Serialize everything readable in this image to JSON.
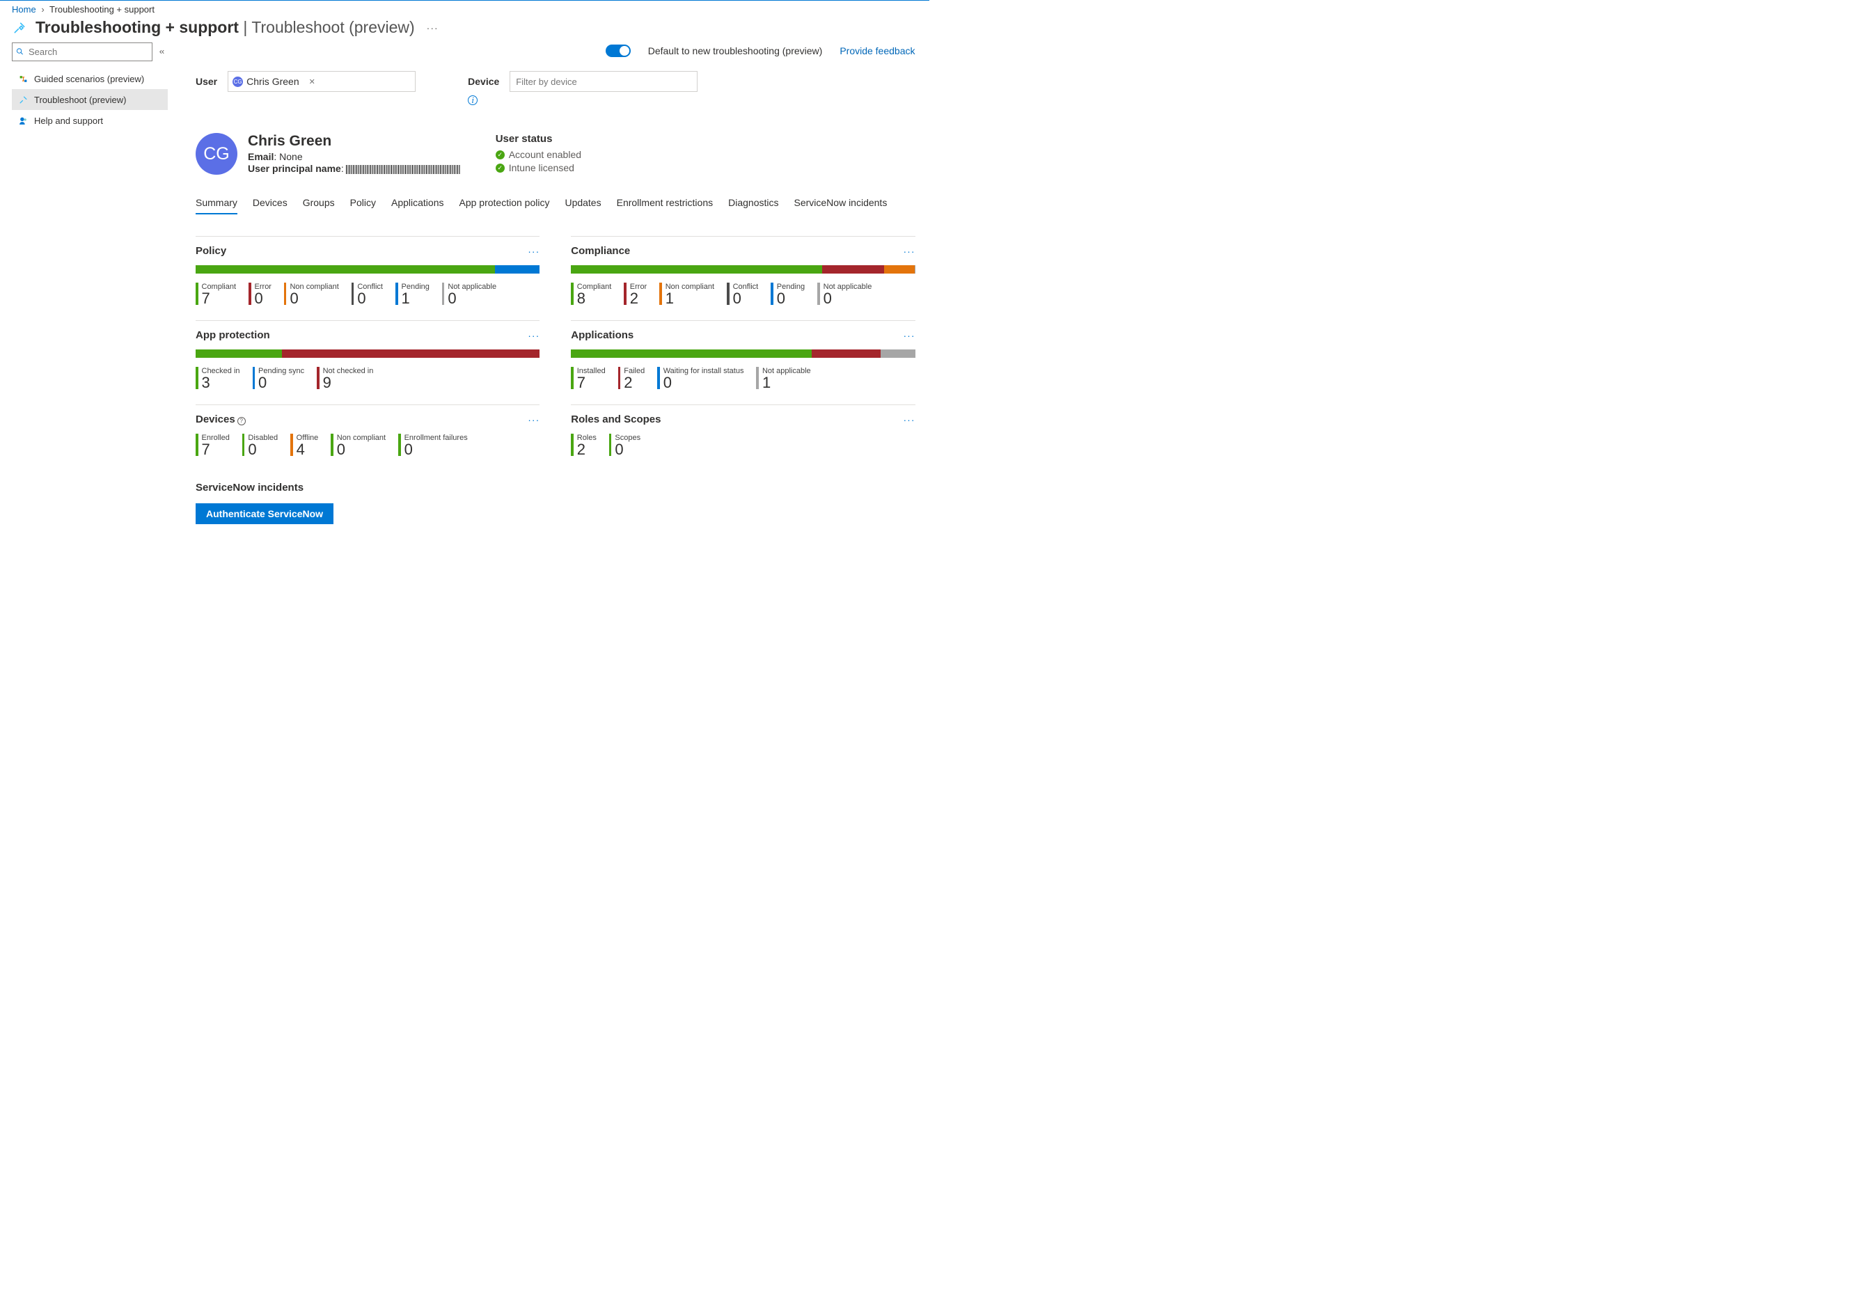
{
  "breadcrumb": {
    "home": "Home",
    "current": "Troubleshooting + support"
  },
  "header": {
    "title": "Troubleshooting + support",
    "subtitle": "Troubleshoot (preview)"
  },
  "sidebar": {
    "search_placeholder": "Search",
    "items": [
      {
        "label": "Guided scenarios (preview)"
      },
      {
        "label": "Troubleshoot (preview)"
      },
      {
        "label": "Help and support"
      }
    ]
  },
  "toprow": {
    "toggle_label": "Default to new troubleshooting (preview)",
    "feedback": "Provide feedback"
  },
  "filters": {
    "user_label": "User",
    "user_chip": "Chris Green",
    "user_initials": "CG",
    "device_label": "Device",
    "device_placeholder": "Filter by device"
  },
  "user": {
    "initials": "CG",
    "name": "Chris Green",
    "email_label": "Email",
    "email_value": "None",
    "upn_label": "User principal name",
    "status_header": "User status",
    "status_lines": [
      "Account enabled",
      "Intune licensed"
    ]
  },
  "tabs": [
    "Summary",
    "Devices",
    "Groups",
    "Policy",
    "Applications",
    "App protection policy",
    "Updates",
    "Enrollment restrictions",
    "Diagnostics",
    "ServiceNow incidents"
  ],
  "colors": {
    "green": "#4aa612",
    "red": "#a4262c",
    "orange": "#e3740c",
    "gray": "#a6a6a6",
    "blue": "#0078d4",
    "dark": "#4c4c4c"
  },
  "cards": [
    {
      "title": "Policy",
      "segments": [
        {
          "c": "green",
          "w": 87
        },
        {
          "c": "blue",
          "w": 13
        }
      ],
      "stats": [
        {
          "label": "Compliant",
          "value": "7",
          "c": "green"
        },
        {
          "label": "Error",
          "value": "0",
          "c": "red"
        },
        {
          "label": "Non compliant",
          "value": "0",
          "c": "orange"
        },
        {
          "label": "Conflict",
          "value": "0",
          "c": "dark"
        },
        {
          "label": "Pending",
          "value": "1",
          "c": "blue"
        },
        {
          "label": "Not applicable",
          "value": "0",
          "c": "gray"
        }
      ]
    },
    {
      "title": "Compliance",
      "segments": [
        {
          "c": "green",
          "w": 73
        },
        {
          "c": "red",
          "w": 18
        },
        {
          "c": "orange",
          "w": 9
        }
      ],
      "stats": [
        {
          "label": "Compliant",
          "value": "8",
          "c": "green"
        },
        {
          "label": "Error",
          "value": "2",
          "c": "red"
        },
        {
          "label": "Non compliant",
          "value": "1",
          "c": "orange"
        },
        {
          "label": "Conflict",
          "value": "0",
          "c": "dark"
        },
        {
          "label": "Pending",
          "value": "0",
          "c": "blue"
        },
        {
          "label": "Not applicable",
          "value": "0",
          "c": "gray"
        }
      ]
    },
    {
      "title": "App protection",
      "segments": [
        {
          "c": "green",
          "w": 25
        },
        {
          "c": "red",
          "w": 75
        }
      ],
      "stats": [
        {
          "label": "Checked in",
          "value": "3",
          "c": "green"
        },
        {
          "label": "Pending sync",
          "value": "0",
          "c": "blue"
        },
        {
          "label": "Not checked in",
          "value": "9",
          "c": "red"
        }
      ]
    },
    {
      "title": "Applications",
      "segments": [
        {
          "c": "green",
          "w": 70
        },
        {
          "c": "red",
          "w": 20
        },
        {
          "c": "gray",
          "w": 10
        }
      ],
      "stats": [
        {
          "label": "Installed",
          "value": "7",
          "c": "green"
        },
        {
          "label": "Failed",
          "value": "2",
          "c": "red"
        },
        {
          "label": "Waiting for install status",
          "value": "0",
          "c": "blue"
        },
        {
          "label": "Not applicable",
          "value": "1",
          "c": "gray"
        }
      ]
    },
    {
      "title": "Devices",
      "info": true,
      "nobar": true,
      "stats": [
        {
          "label": "Enrolled",
          "value": "7",
          "c": "green"
        },
        {
          "label": "Disabled",
          "value": "0",
          "c": "green"
        },
        {
          "label": "Offline",
          "value": "4",
          "c": "orange"
        },
        {
          "label": "Non compliant",
          "value": "0",
          "c": "green"
        },
        {
          "label": "Enrollment failures",
          "value": "0",
          "c": "green"
        }
      ]
    },
    {
      "title": "Roles and Scopes",
      "nobar": true,
      "stats": [
        {
          "label": "Roles",
          "value": "2",
          "c": "green"
        },
        {
          "label": "Scopes",
          "value": "0",
          "c": "green"
        }
      ]
    }
  ],
  "incidents": {
    "title": "ServiceNow incidents",
    "button": "Authenticate ServiceNow"
  }
}
